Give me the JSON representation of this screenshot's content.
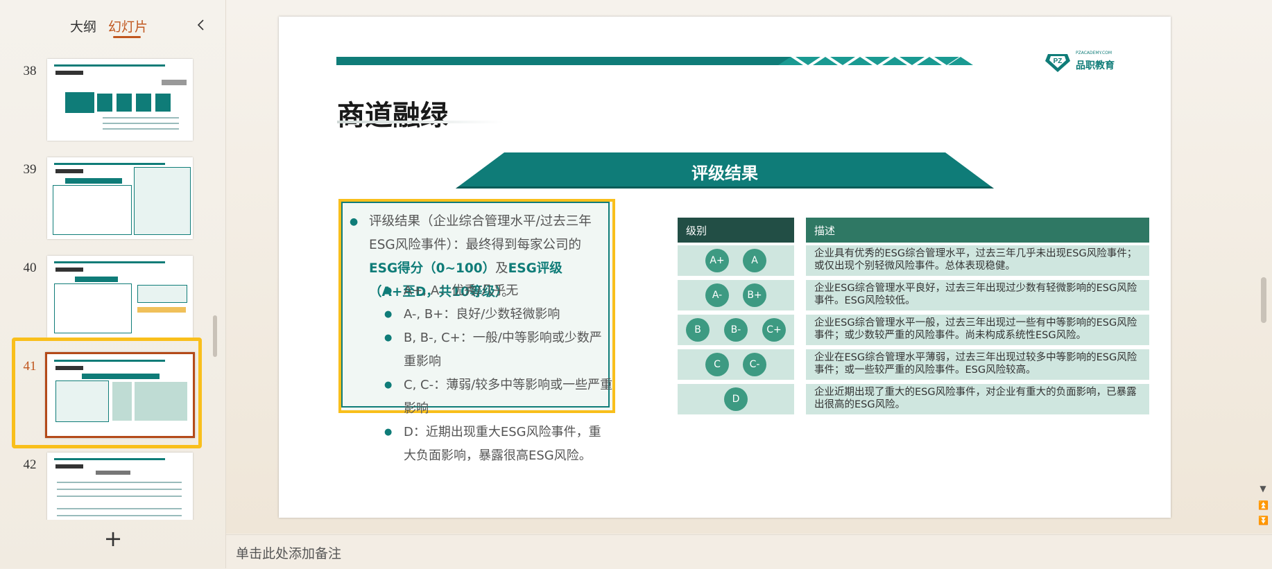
{
  "panel": {
    "tabs": [
      {
        "label": "大纲"
      },
      {
        "label": "幻灯片"
      }
    ],
    "thumbnails": [
      {
        "number": "38"
      },
      {
        "number": "39"
      },
      {
        "number": "40"
      },
      {
        "number": "41"
      },
      {
        "number": "42"
      }
    ],
    "selected_slide": "41"
  },
  "notes": {
    "placeholder": "单击此处添加备注"
  },
  "slide": {
    "logo": {
      "small": "PZACADEMY.COM",
      "name": "品职教育",
      "mark": "PZ"
    },
    "title": "商道融绿",
    "banner": "评级结果",
    "main_bullet": {
      "part1": "评级结果（企业综合管理水平/过去三年ESG风险事件）：最终得到每家公司的",
      "em1": "ESG得分（0~100）",
      "part2": "及",
      "em2": "ESG评级（A+至D，共10等级）",
      "part3": "。"
    },
    "sub_bullets": [
      "A+, A：优秀/几乎无",
      "A-, B+：良好/少数轻微影响",
      "B, B-, C+：一般/中等影响或少数严重影响",
      "C, C-：薄弱/较多中等影响或一些严重影响",
      "D：近期出现重大ESG风险事件，重大负面影响，暴露很高ESG风险。"
    ],
    "table": {
      "level_header": "级别",
      "desc_header": "描述",
      "rows": [
        {
          "levels": [
            "A+",
            "A"
          ],
          "desc": "企业具有优秀的ESG综合管理水平，过去三年几乎未出现ESG风险事件；或仅出现个别轻微风险事件。总体表现稳健。"
        },
        {
          "levels": [
            "A-",
            "B+"
          ],
          "desc": "企业ESG综合管理水平良好，过去三年出现过少数有轻微影响的ESG风险事件。ESG风险较低。"
        },
        {
          "levels": [
            "B",
            "B-",
            "C+"
          ],
          "desc": "企业ESG综合管理水平一般，过去三年出现过一些有中等影响的ESG风险事件；或少数较严重的风险事件。尚未构成系统性ESG风险。"
        },
        {
          "levels": [
            "C",
            "C-"
          ],
          "desc": "企业在ESG综合管理水平薄弱，过去三年出现过较多中等影响的ESG风险事件；或一些较严重的风险事件。ESG风险较高。"
        },
        {
          "levels": [
            "D"
          ],
          "desc": "企业近期出现了重大的ESG风险事件，对企业有重大的负面影响，已暴露出很高的ESG风险。"
        }
      ]
    }
  },
  "colors": {
    "teal": "#0f7c78",
    "accent": "#c0571f",
    "highlight": "#f9bf1c"
  }
}
